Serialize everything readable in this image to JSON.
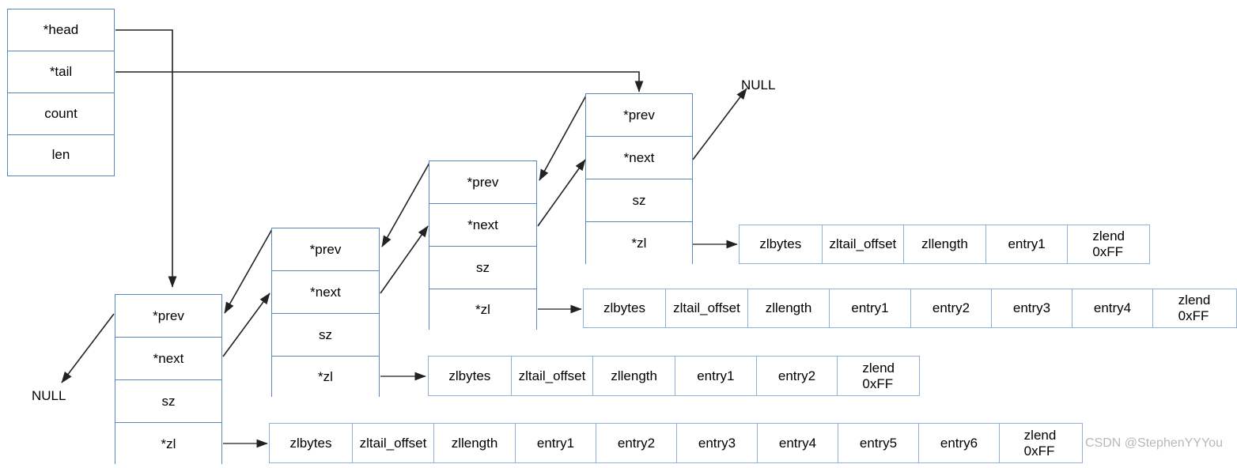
{
  "diagram": {
    "title": "Redis quicklist structure diagram",
    "colors": {
      "struct_border": "#5b87bf",
      "ziplist_border": "#8fb0d8",
      "wire": "#222222",
      "text": "#000000",
      "watermark": "#b8b8b8",
      "background": "#ffffff"
    },
    "watermark": "CSDN @StephenYYYou",
    "null_labels": [
      {
        "name": "null-tail-next",
        "text": "NULL"
      },
      {
        "name": "null-head-prev",
        "text": "NULL"
      }
    ],
    "quicklist": {
      "name": "quicklist-header",
      "fields": [
        "*head",
        "*tail",
        "count",
        "len"
      ]
    },
    "node_fields": [
      "*prev",
      "*next",
      "sz",
      "*zl"
    ],
    "nodes": [
      {
        "name": "quicklist-node-1",
        "fields": [
          "*prev",
          "*next",
          "sz",
          "*zl"
        ]
      },
      {
        "name": "quicklist-node-2",
        "fields": [
          "*prev",
          "*next",
          "sz",
          "*zl"
        ]
      },
      {
        "name": "quicklist-node-3",
        "fields": [
          "*prev",
          "*next",
          "sz",
          "*zl"
        ]
      },
      {
        "name": "quicklist-node-4",
        "fields": [
          "*prev",
          "*next",
          "sz",
          "*zl"
        ]
      }
    ],
    "ziplists": [
      {
        "name": "ziplist-node-4",
        "cells": [
          "zlbytes",
          "zltail_offset",
          "zllength",
          "entry1",
          "zlend\n0xFF"
        ],
        "entry_count": 1
      },
      {
        "name": "ziplist-node-3",
        "cells": [
          "zlbytes",
          "zltail_offset",
          "zllength",
          "entry1",
          "entry2",
          "entry3",
          "entry4",
          "zlend\n0xFF"
        ],
        "entry_count": 4
      },
      {
        "name": "ziplist-node-2",
        "cells": [
          "zlbytes",
          "zltail_offset",
          "zllength",
          "entry1",
          "entry2",
          "zlend\n0xFF"
        ],
        "entry_count": 2
      },
      {
        "name": "ziplist-node-1",
        "cells": [
          "zlbytes",
          "zltail_offset",
          "zllength",
          "entry1",
          "entry2",
          "entry3",
          "entry4",
          "entry5",
          "entry6",
          "zlend\n0xFF"
        ],
        "entry_count": 6
      }
    ]
  }
}
